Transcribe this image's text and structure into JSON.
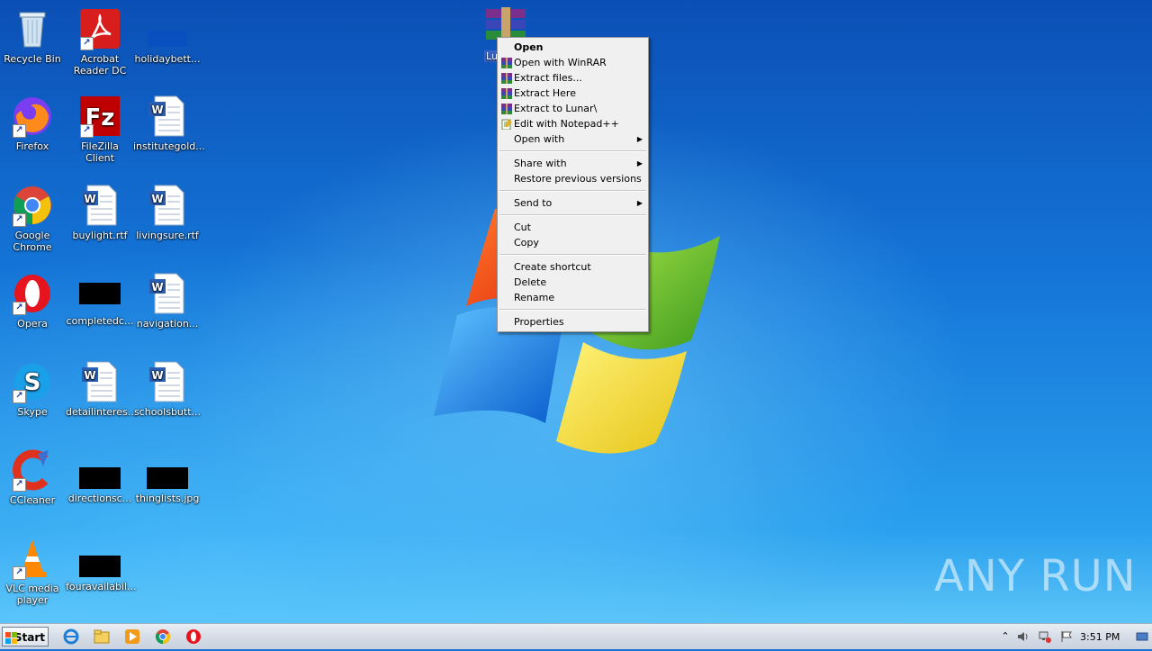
{
  "desktop_icons": {
    "col1": [
      "Recycle Bin",
      "Acrobat Reader DC",
      "Firefox",
      "Google Chrome",
      "Opera",
      "Skype",
      "CCleaner",
      "VLC media player"
    ],
    "recycle_bin": "Recycle Bin",
    "acrobat": "Acrobat\nReader DC",
    "holiday": "holidaybett...",
    "firefox": "Firefox",
    "filezilla": "FileZilla Client",
    "institute": "institutegold...",
    "chrome": "Google\nChrome",
    "buylight": "buylight.rtf",
    "livingsure": "livingsure.rtf",
    "opera": "Opera",
    "completed": "completedc...",
    "navigation": "navigation...",
    "skype": "Skype",
    "detail": "detailinteres...",
    "schools": "schoolsbutt...",
    "ccleaner": "CCleaner",
    "directions": "directionsc...",
    "thinglists": "thinglists.jpg",
    "vlc": "VLC media\nplayer",
    "fouravail": "fouravailabil...",
    "lunar": "Lun"
  },
  "context_menu": {
    "open": "Open",
    "open_winrar": "Open with WinRAR",
    "extract_files": "Extract files...",
    "extract_here": "Extract Here",
    "extract_to": "Extract to Lunar\\",
    "edit_notepad": "Edit with Notepad++",
    "open_with": "Open with",
    "share_with": "Share with",
    "restore": "Restore previous versions",
    "send_to": "Send to",
    "cut": "Cut",
    "copy": "Copy",
    "create_shortcut": "Create shortcut",
    "delete": "Delete",
    "rename": "Rename",
    "properties": "Properties"
  },
  "taskbar": {
    "start_label": "Start",
    "clock": "3:51 PM"
  },
  "watermark": "ANY RUN"
}
